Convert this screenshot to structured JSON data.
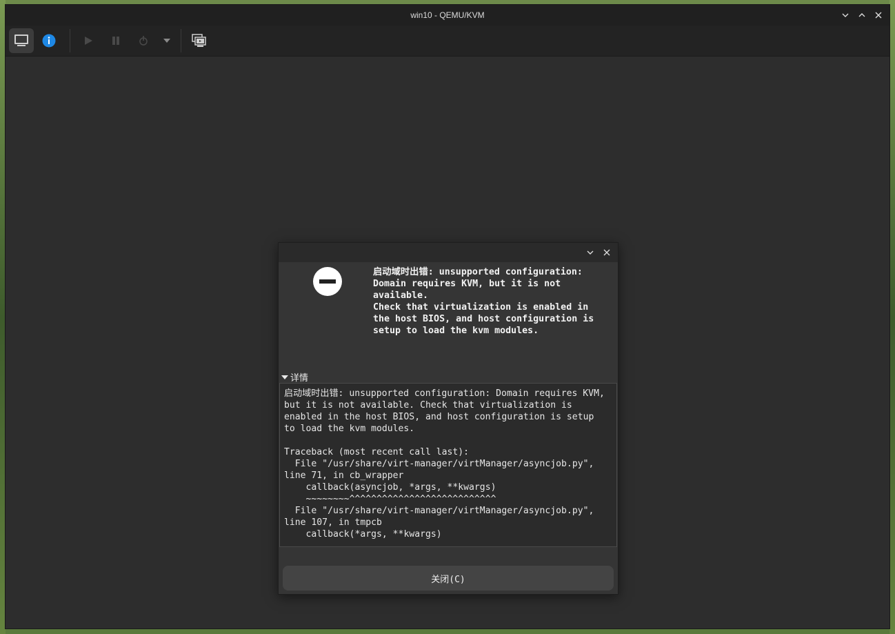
{
  "window": {
    "title": "win10 - QEMU/KVM"
  },
  "toolbar": {
    "items": [
      {
        "name": "console-view",
        "icon": "monitor-icon",
        "active": true
      },
      {
        "name": "details-view",
        "icon": "info-icon"
      },
      {
        "name": "run",
        "icon": "play-icon",
        "disabled": true
      },
      {
        "name": "pause",
        "icon": "pause-icon",
        "disabled": true
      },
      {
        "name": "shutdown",
        "icon": "power-icon",
        "disabled": true
      },
      {
        "name": "shutdown-menu",
        "icon": "chevron-down-icon"
      },
      {
        "name": "snapshots",
        "icon": "snapshot-icon"
      }
    ]
  },
  "dialog": {
    "icon": "error-icon",
    "primary_message": "启动域时出错: unsupported configuration:\nDomain requires KVM, but it is not\navailable.\nCheck that virtualization is enabled in\nthe host BIOS, and host configuration is\nsetup to load the kvm modules.",
    "details_label": "详情",
    "details_text": "启动域时出错: unsupported configuration: Domain requires KVM,\nbut it is not available. Check that virtualization is\nenabled in the host BIOS, and host configuration is setup\nto load the kvm modules.\n\nTraceback (most recent call last):\n  File \"/usr/share/virt-manager/virtManager/asyncjob.py\",\nline 71, in cb_wrapper\n    callback(asyncjob, *args, **kwargs)\n    ~~~~~~~~^^^^^^^^^^^^^^^^^^^^^^^^^^^\n  File \"/usr/share/virt-manager/virtManager/asyncjob.py\",\nline 107, in tmpcb\n    callback(*args, **kwargs)",
    "close_label": "关闭(C)"
  },
  "colors": {
    "window_bg": "#2d2d2d",
    "info_accent": "#1e88e5",
    "error_icon_bg": "#ffffff"
  }
}
